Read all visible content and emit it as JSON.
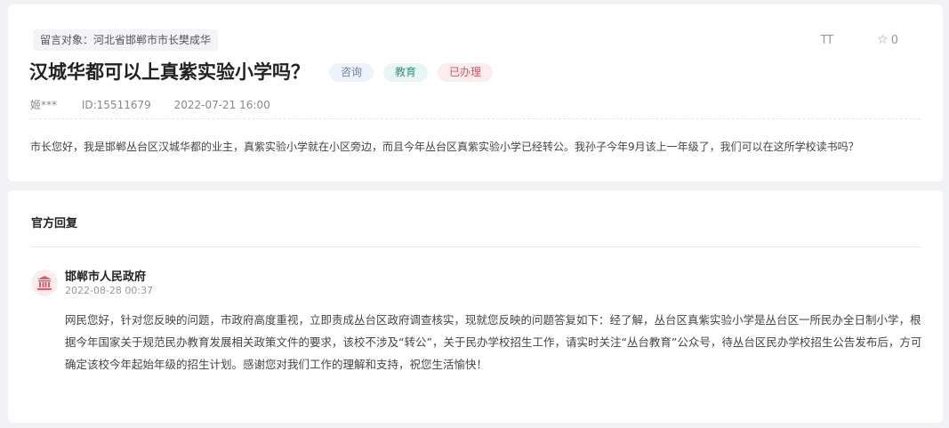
{
  "question": {
    "target": "留言对象：河北省邯郸市市长樊成华",
    "title": "汉城华都可以上真紫实验小学吗？",
    "tags": [
      "咨询",
      "教育",
      "已办理"
    ],
    "font_tool": "TT",
    "star_count": "0",
    "user": "姬***",
    "id": "ID:15511679",
    "datetime": "2022-07-21 16:00",
    "content": "市长您好，我是邯郸丛台区汉城华都的业主，真紫实验小学就在小区旁边，而且今年丛台区真紫实验小学已经转公。我孙子今年9月该上一年级了，我们可以在这所学校读书吗？"
  },
  "reply": {
    "heading": "官方回复",
    "org": "邯郸市人民政府",
    "date": "2022-08-28 00:37",
    "text": "网民您好，针对您反映的问题，市政府高度重视，立即责成丛台区政府调查核实，现就您反映的问题答复如下：经了解，丛台区真紫实验小学是丛台区一所民办全日制小学，根据今年国家关于规范民办教育发展相关政策文件的要求，该校不涉及“转公”，关于民办学校招生工作，请实时关注“丛台教育”公众号，待丛台区民办学校招生公告发布后，方可确定该校今年起始年级的招生计划。感谢您对我们工作的理解和支持，祝您生活愉快！"
  },
  "colors": {
    "tag_blue": "#6c84a8",
    "tag_teal": "#3a8e86",
    "tag_red": "#e0505f",
    "avatar_icon": "#e35b68"
  }
}
